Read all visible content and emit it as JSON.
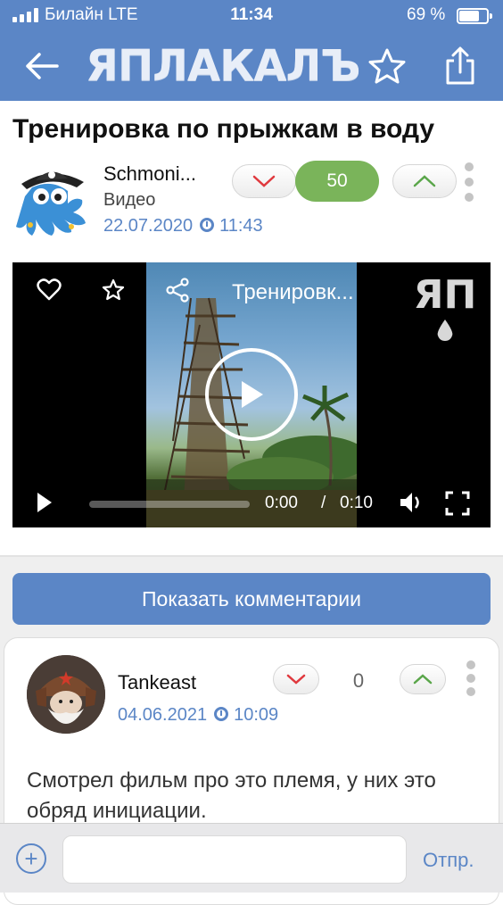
{
  "status_bar": {
    "carrier": "Билайн  LTE",
    "time": "11:34",
    "battery": "69 %",
    "battery_level": 0.69
  },
  "nav": {
    "back_icon": "arrow-left-icon",
    "logo_text": "ЯПЛАКАЛЪ",
    "favorite_icon": "star-outline-icon",
    "share_icon": "share-icon"
  },
  "post": {
    "title": "Тренировка по прыжкам в воду",
    "author": "Schmoni...",
    "category": "Видео",
    "date": "22.07.2020",
    "time": "11:43",
    "rating": "50",
    "vote_down_icon": "chevron-down-icon",
    "vote_up_icon": "chevron-up-icon",
    "menu_icon": "more-vertical-icon"
  },
  "video": {
    "title": "Тренировк...",
    "watermark": "ЯП",
    "current_time": "0:00",
    "separator": "/",
    "duration": "0:10",
    "icons": [
      "heart-icon",
      "star-icon",
      "share-icon",
      "play-icon",
      "volume-icon",
      "fullscreen-icon"
    ]
  },
  "comments": {
    "show_button": "Показать комментарии",
    "items": [
      {
        "author": "Tankeast",
        "date": "04.06.2021",
        "time": "10:09",
        "rating": "0",
        "text": "Смотрел фильм про это племя, у них это обряд инициации."
      }
    ]
  },
  "input_bar": {
    "placeholder": "",
    "send_label": "Отпр.",
    "add_icon": "plus-circle-icon"
  },
  "colors": {
    "brand_blue": "#5b86c6",
    "rating_green": "#7ab45a",
    "vote_down_red": "#e0393e",
    "vote_up_green": "#5aa64a"
  }
}
